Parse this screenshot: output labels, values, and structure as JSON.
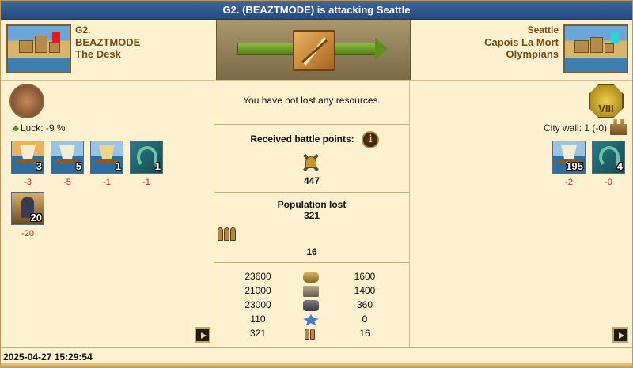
{
  "title": "G2. (BEAZTMODE) is attacking Seattle",
  "attacker": {
    "town": "G2.",
    "player": "BEAZTMODE",
    "alliance": "The Desk",
    "luck": "Luck: -9 %",
    "units": [
      {
        "name": "fire-ship",
        "count": "3",
        "loss": "-3"
      },
      {
        "name": "transport-boat",
        "count": "5",
        "loss": "-5"
      },
      {
        "name": "bireme",
        "count": "1",
        "loss": "-1"
      },
      {
        "name": "sea-monster",
        "count": "1",
        "loss": "-1"
      },
      {
        "name": "chariot",
        "count": "20",
        "loss": "-20"
      }
    ]
  },
  "defender": {
    "town": "Seattle",
    "player": "Capois La Mort",
    "alliance": "Olympians",
    "god_badge": "VIII",
    "city_wall": "City wall: 1 (-0)",
    "units": [
      {
        "name": "transport-boat",
        "count": "195",
        "loss": "-2"
      },
      {
        "name": "sea-monster",
        "count": "4",
        "loss": "-0"
      }
    ]
  },
  "summary": {
    "resources_text": "You have not lost any resources.",
    "battle_points_label": "Received battle points:",
    "battle_points": "447",
    "population_label": "Population lost",
    "population_attacker": "321",
    "population_defender": "16",
    "info_icon": "i",
    "resources": [
      {
        "icon": "wood-icon",
        "attacker": "23600",
        "defender": "1600"
      },
      {
        "icon": "stone-icon",
        "attacker": "21000",
        "defender": "1400"
      },
      {
        "icon": "silver-icon",
        "attacker": "23000",
        "defender": "360"
      },
      {
        "icon": "favor-icon",
        "attacker": "110",
        "defender": "0"
      },
      {
        "icon": "population-icon",
        "attacker": "321",
        "defender": "16"
      }
    ]
  },
  "timestamp": "2025-04-27 15:29:54",
  "colors": {
    "title_bar": "#2f578f",
    "background": "#fdf1cf",
    "loss_red": "#c0281c",
    "header_text": "#7a4a14"
  }
}
